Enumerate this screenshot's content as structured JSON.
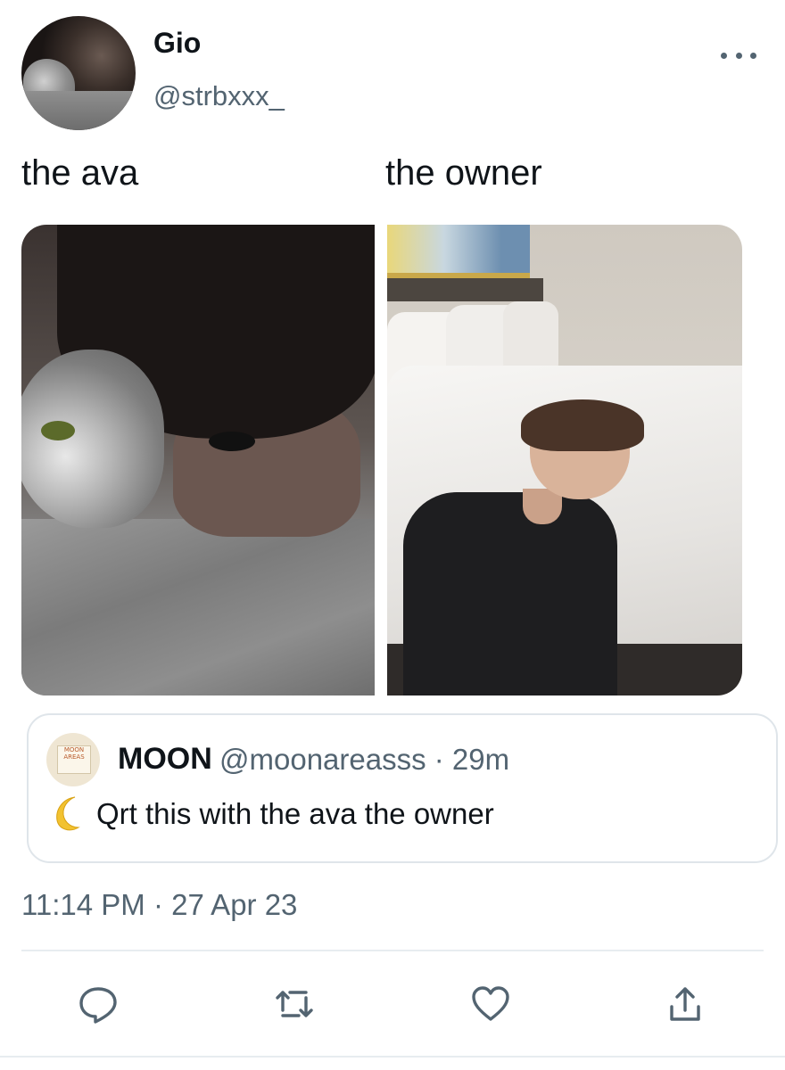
{
  "author": {
    "display_name": "Gio",
    "handle": "@strbxxx_",
    "avatar_icon": "avatar-photo"
  },
  "tweet": {
    "text_left": "the ava",
    "text_right": "the owner"
  },
  "media": [
    {
      "label": "ava-photo"
    },
    {
      "label": "owner-photo"
    }
  ],
  "quoted_tweet": {
    "display_name": "MOON",
    "handle_time": "@moonareasss · 29m",
    "avatar_text": "MOON AREAS",
    "emoji_icon": "crescent-moon-icon",
    "text": "Qrt this with the ava the owner"
  },
  "timestamp": "11:14 PM · 27 Apr 23",
  "actions": [
    {
      "name": "reply",
      "icon": "reply-icon"
    },
    {
      "name": "retweet",
      "icon": "retweet-icon"
    },
    {
      "name": "like",
      "icon": "heart-icon"
    },
    {
      "name": "share",
      "icon": "share-icon"
    }
  ],
  "colors": {
    "text_primary": "#0f1419",
    "text_secondary": "#536471",
    "border": "#dfe5ea",
    "icon": "#536471"
  }
}
